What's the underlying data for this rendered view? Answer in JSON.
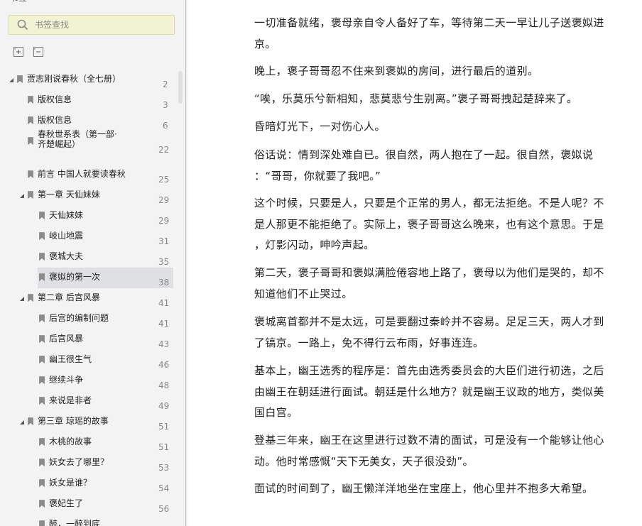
{
  "panel": {
    "title": "书签",
    "close": "×"
  },
  "search": {
    "placeholder": "书签查找"
  },
  "toc": [
    {
      "label": "贾志刚说春秋（全七册）",
      "page": "2",
      "level": 0,
      "expanded": true
    },
    {
      "label": "版权信息",
      "page": "3",
      "level": 1
    },
    {
      "label": "版权信息",
      "page": "6",
      "level": 1
    },
    {
      "label": "春秋世系表（第一部·齐楚崛起）",
      "line1": "春秋世系表（第一部·",
      "line2": "齐楚崛起）",
      "page": "22",
      "level": 1,
      "tall": true
    },
    {
      "label": "前言 中国人就要读春秋",
      "page": "25",
      "level": 1
    },
    {
      "label": "第一章 天仙妹妹",
      "page": "29",
      "level": 1,
      "expanded": true
    },
    {
      "label": "天仙妹妹",
      "page": "29",
      "level": 2
    },
    {
      "label": "岐山地震",
      "page": "31",
      "level": 2
    },
    {
      "label": "褒城大夫",
      "page": "35",
      "level": 2
    },
    {
      "label": "褒姒的第一次",
      "page": "38",
      "level": 2,
      "selected": true
    },
    {
      "label": "第二章 后宫风暴",
      "page": "41",
      "level": 1,
      "expanded": true
    },
    {
      "label": "后宫的编制问题",
      "page": "41",
      "level": 2
    },
    {
      "label": "后宫风暴",
      "page": "43",
      "level": 2
    },
    {
      "label": "幽王很生气",
      "page": "46",
      "level": 2
    },
    {
      "label": "继续斗争",
      "page": "48",
      "level": 2
    },
    {
      "label": "来说是非者",
      "page": "49",
      "level": 2
    },
    {
      "label": "第三章 琼瑶的故事",
      "page": "51",
      "level": 1,
      "expanded": true
    },
    {
      "label": "木桃的故事",
      "page": "51",
      "level": 2
    },
    {
      "label": "妖女去了哪里？",
      "page": "53",
      "level": 2
    },
    {
      "label": "妖女是谁？",
      "page": "54",
      "level": 2
    },
    {
      "label": "褒妃生了",
      "page": "56",
      "level": 2
    },
    {
      "label": "醉，一醉到底",
      "page": "",
      "level": 2
    }
  ],
  "content": [
    {
      "lines": [
        "一切准备就绪，褒母亲自令人备好了车，等待第二天一早让儿子送褒姒进",
        "京。"
      ]
    },
    {
      "lines": [
        "晚上，褒子哥哥忍不住来到褒姒的房间，进行最后的道别。"
      ]
    },
    {
      "lines": [
        "“唉，乐莫乐兮新相知，悲莫悲兮生别离。”褒子哥哥拽起楚辞来了。"
      ]
    },
    {
      "lines": [
        "昏暗灯光下，一对伤心人。"
      ]
    },
    {
      "lines": [
        "俗话说：情到深处难自已。很自然，两人抱在了一起。很自然，褒姒说",
        "：“哥哥，你就要了我吧。”"
      ]
    },
    {
      "lines": [
        "这个时候，只要是人，只要是个正常的男人，都无法拒绝。不是人呢？不",
        "是人那更不能拒绝了。实际上，褒子哥哥这么晚来，也有这个意思。于是",
        "，灯影闪动，呻吟声起。"
      ]
    },
    {
      "lines": [
        "第二天，褒子哥哥和褒姒满脸倦容地上路了，褒母以为他们是哭的，却不",
        "知道他们不止哭过。"
      ]
    },
    {
      "lines": [
        "褒城离首都并不是太远，可是要翻过秦岭并不容易。足足三天，两人才到",
        "了镐京。一路上，免不得行云布雨，好事连连。"
      ]
    },
    {
      "lines": [
        "基本上，幽王选秀的程序是：首先由选秀委员会的大臣们进行初选，之后",
        "由幽王在朝廷进行面试。朝廷是什么地方？就是幽王议政的地方，类似美",
        "国白宫。"
      ]
    },
    {
      "lines": [
        "登基三年来，幽王在这里进行过数不清的面试，可是没有一个能够让他心",
        "动。他时常感慨“天下无美女，天子很没劲”。"
      ]
    },
    {
      "lines": [
        "面试的时间到了，幽王懒洋洋地坐在宝座上，他心里并不抱多大希望。"
      ]
    }
  ]
}
